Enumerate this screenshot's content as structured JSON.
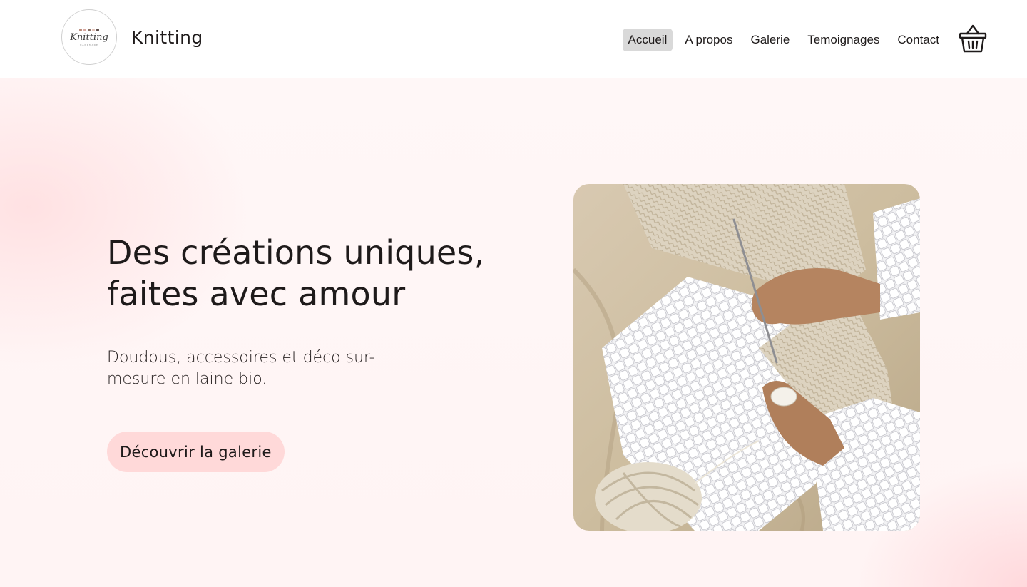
{
  "brand": {
    "name": "Knitting",
    "logo_script": "Knitting",
    "logo_subtitle": "HANDMADE"
  },
  "nav": {
    "items": [
      {
        "label": "Accueil",
        "active": true
      },
      {
        "label": "A propos",
        "active": false
      },
      {
        "label": "Galerie",
        "active": false
      },
      {
        "label": "Temoignages",
        "active": false
      },
      {
        "label": "Contact",
        "active": false
      }
    ],
    "cart_icon": "basket-icon"
  },
  "hero": {
    "title": "Des créations uniques, faites avec amour",
    "subtitle": "Doudous, accessoires et déco sur-mesure en laine bio.",
    "cta_label": "Découvrir la galerie",
    "image_subject": "hands-knitting-icon"
  },
  "colors": {
    "accent": "#ffd9d9",
    "hero_background": "#fff5f5",
    "nav_active": "#d9d9d9",
    "text": "#1e1a1a"
  }
}
